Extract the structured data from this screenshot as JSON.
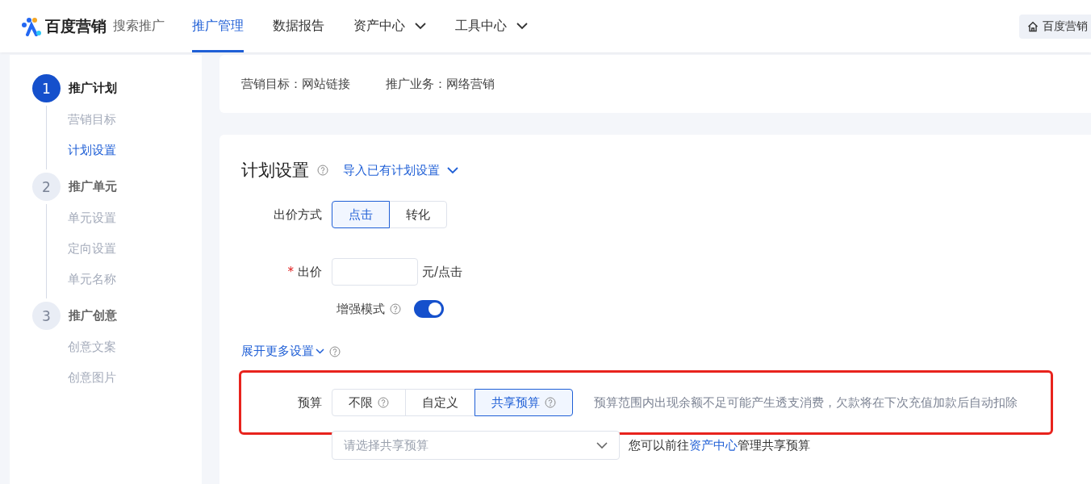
{
  "header": {
    "logo_text": "百度营销",
    "product": "搜索推广",
    "nav": [
      {
        "label": "推广管理",
        "selected": true,
        "dropdown": false
      },
      {
        "label": "数据报告",
        "selected": false,
        "dropdown": false
      },
      {
        "label": "资产中心",
        "selected": false,
        "dropdown": true
      },
      {
        "label": "工具中心",
        "selected": false,
        "dropdown": true
      }
    ],
    "home_button": "百度营销"
  },
  "steps": [
    {
      "number": "1",
      "title": "推广计划",
      "active": true,
      "items": [
        {
          "label": "营销目标",
          "selected": false
        },
        {
          "label": "计划设置",
          "selected": true
        }
      ]
    },
    {
      "number": "2",
      "title": "推广单元",
      "active": false,
      "items": [
        {
          "label": "单元设置",
          "selected": false
        },
        {
          "label": "定向设置",
          "selected": false
        },
        {
          "label": "单元名称",
          "selected": false
        }
      ]
    },
    {
      "number": "3",
      "title": "推广创意",
      "active": false,
      "items": [
        {
          "label": "创意文案",
          "selected": false
        },
        {
          "label": "创意图片",
          "selected": false
        }
      ]
    }
  ],
  "summary": [
    {
      "label": "营销目标：",
      "value": "网站链接"
    },
    {
      "label": "推广业务：",
      "value": "网络营销"
    }
  ],
  "plan": {
    "title": "计划设置",
    "import_link": "导入已有计划设置",
    "bid_method": {
      "label": "出价方式",
      "options": [
        {
          "label": "点击",
          "selected": true
        },
        {
          "label": "转化",
          "selected": false
        }
      ]
    },
    "bid": {
      "label": "出价",
      "required_mark": "*",
      "unit": "元/点击"
    },
    "enhance": {
      "label": "增强模式",
      "on": true
    },
    "more_link": "展开更多设置",
    "budget": {
      "label": "预算",
      "options": [
        {
          "label": "不限",
          "selected": false,
          "help": true
        },
        {
          "label": "自定义",
          "selected": false,
          "help": false
        },
        {
          "label": "共享预算",
          "selected": true,
          "help": true
        }
      ],
      "note": "预算范围内出现余额不足可能产生透支消费，欠款将在下次充值加款后自动扣除"
    },
    "shared_select": {
      "placeholder": "请选择共享预算"
    },
    "hint": {
      "before": "您可以前往",
      "link": "资产中心",
      "after": "管理共享预算"
    }
  }
}
